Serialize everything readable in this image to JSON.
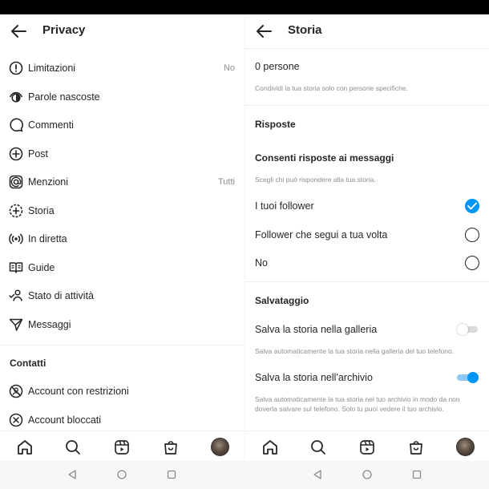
{
  "left": {
    "title": "Privacy",
    "items": [
      {
        "label": "Limitazioni",
        "value": "No"
      },
      {
        "label": "Parole nascoste",
        "value": ""
      },
      {
        "label": "Commenti",
        "value": ""
      },
      {
        "label": "Post",
        "value": ""
      },
      {
        "label": "Menzioni",
        "value": "Tutti"
      },
      {
        "label": "Storia",
        "value": ""
      },
      {
        "label": "In diretta",
        "value": ""
      },
      {
        "label": "Guide",
        "value": ""
      },
      {
        "label": "Stato di attività",
        "value": ""
      },
      {
        "label": "Messaggi",
        "value": ""
      }
    ],
    "contacts_heading": "Contatti",
    "contacts": [
      {
        "label": "Account con restrizioni"
      },
      {
        "label": "Account bloccati"
      }
    ]
  },
  "right": {
    "title": "Storia",
    "people_count": "0 persone",
    "people_hint": "Condividi la tua storia solo con persone specifiche.",
    "replies_heading": "Risposte",
    "allow_replies_heading": "Consenti risposte ai messaggi",
    "allow_replies_hint": "Scegli chi può rispondere alla tua storia.",
    "reply_options": [
      {
        "label": "I tuoi follower",
        "selected": true
      },
      {
        "label": "Follower che segui a tua volta",
        "selected": false
      },
      {
        "label": "No",
        "selected": false
      }
    ],
    "saving_heading": "Salvataggio",
    "save_gallery_label": "Salva la storia nella galleria",
    "save_gallery_on": false,
    "save_gallery_hint": "Salva automaticamente la tua storia nella galleria del tuo telefono.",
    "save_archive_label": "Salva la storia nell'archivio",
    "save_archive_on": true,
    "save_archive_hint": "Salva automaticamente la tua storia nel tuo archivio in modo da non doverla salvare sul telefono. Solo tu puoi vedere il tuo archivio."
  },
  "colors": {
    "accent": "#0095f6",
    "text": "#262626",
    "secondary_text": "#8e8e8e"
  },
  "nav_icons": [
    "home-icon",
    "search-icon",
    "reels-icon",
    "shop-icon",
    "profile-avatar"
  ],
  "system_icons": [
    "back-triangle-icon",
    "home-circle-icon",
    "recents-square-icon"
  ]
}
